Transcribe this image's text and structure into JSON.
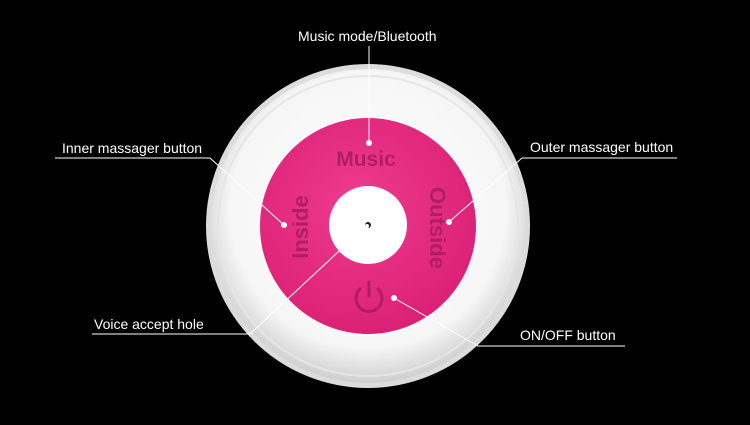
{
  "colors": {
    "background": "#000000",
    "device_rim": "#f4f4f4",
    "button_face": "#e0287d",
    "button_text": "#b01d63",
    "center_hole": "#ffffff",
    "dot": "#ffffff",
    "callout_text": "#ffffff"
  },
  "device": {
    "music_label": "Music",
    "inside_label": "Inside",
    "outside_label": "Outside",
    "power_icon": "power-icon"
  },
  "callouts": {
    "music_mode": "Music mode/Bluetooth",
    "inner_massager": "Inner massager button",
    "outer_massager": "Outer massager button",
    "voice_hole": "Voice accept hole",
    "on_off": "ON/OFF button"
  }
}
